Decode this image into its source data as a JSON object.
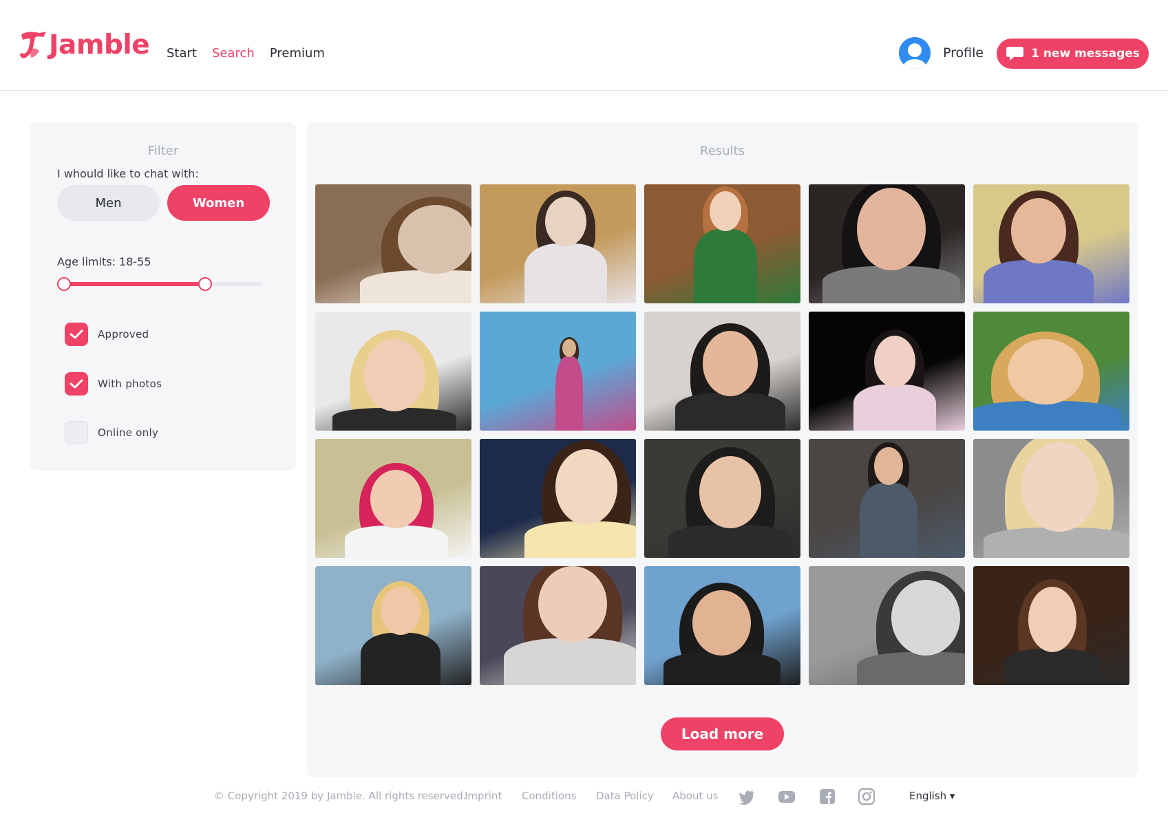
{
  "header": {
    "logo_text": "Jamble",
    "nav": [
      {
        "label": "Start",
        "active": false
      },
      {
        "label": "Search",
        "active": true
      },
      {
        "label": "Premium",
        "active": false
      }
    ],
    "profile_label": "Profile",
    "messages_label": "1 new messages"
  },
  "filter": {
    "title": "Filter",
    "chat_with_label": "I whould like to chat with:",
    "men_label": "Men",
    "women_label": "Women",
    "selected_gender": "Women",
    "age_label": "Age limits: 18-55",
    "age_min": 18,
    "age_max": 55,
    "checkboxes": [
      {
        "label": "Approved",
        "checked": true
      },
      {
        "label": "With photos",
        "checked": true
      },
      {
        "label": "Online only",
        "checked": false
      }
    ]
  },
  "results": {
    "title": "Results",
    "load_more_label": "Load more",
    "photo_count": 20
  },
  "footer": {
    "copyright": "© Copyright 2019 by Jamble. All rights reserved.",
    "links": [
      "Imprint",
      "Conditions",
      "Data Policy",
      "About us"
    ],
    "social_icons": [
      "twitter-icon",
      "youtube-icon",
      "facebook-icon",
      "instagram-icon"
    ],
    "language": "English ▾"
  },
  "colors": {
    "accent": "#ee4266",
    "panel_bg": "#f5f6f8",
    "muted_text": "#a9adb5",
    "avatar_blue": "#2f8bf0"
  }
}
